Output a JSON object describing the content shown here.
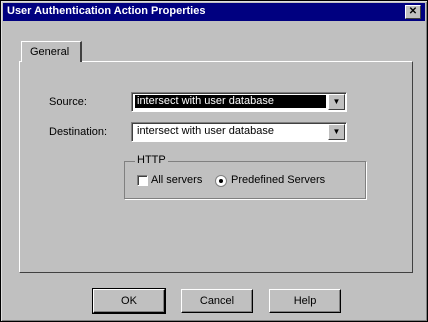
{
  "window": {
    "title": "User Authentication Action Properties",
    "close_glyph": "✕"
  },
  "tabs": [
    {
      "label": "General",
      "selected": true
    }
  ],
  "form": {
    "source": {
      "label": "Source:",
      "value": "intersect with user database",
      "selected": true
    },
    "destination": {
      "label": "Destination:",
      "value": "intersect with user database"
    },
    "http_group": {
      "title": "HTTP",
      "all_servers": {
        "label": "All servers",
        "checked": false
      },
      "predefined_servers": {
        "label": "Predefined Servers",
        "checked": true
      }
    }
  },
  "buttons": {
    "ok": "OK",
    "cancel": "Cancel",
    "help": "Help"
  },
  "icons": {
    "dropdown": "combo-arrow-icon",
    "close": "close-icon"
  }
}
